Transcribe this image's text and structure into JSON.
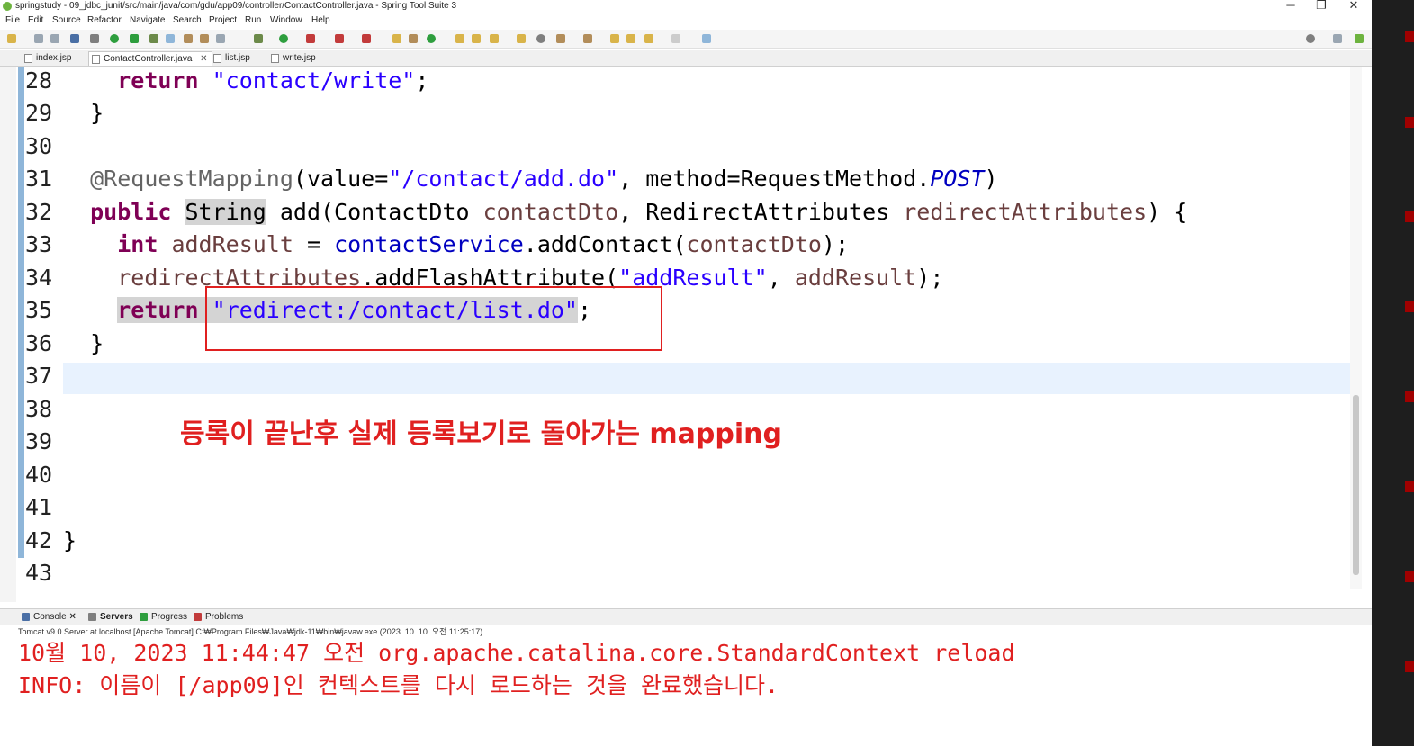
{
  "window": {
    "title": "springstudy - 09_jdbc_junit/src/main/java/com/gdu/app09/controller/ContactController.java - Spring Tool Suite 3",
    "minimize": "─",
    "restore": "❐",
    "close": "✕"
  },
  "menu": [
    "File",
    "Edit",
    "Source",
    "Refactor",
    "Navigate",
    "Search",
    "Project",
    "Run",
    "Window",
    "Help"
  ],
  "tabs": [
    {
      "label": "index.jsp"
    },
    {
      "label": "ContactController.java",
      "close": "✕"
    },
    {
      "label": "list.jsp"
    },
    {
      "label": "write.jsp"
    }
  ],
  "line_numbers": [
    "28",
    "29",
    "30",
    "31",
    "32",
    "33",
    "34",
    "35",
    "36",
    "37",
    "38",
    "39",
    "40",
    "41",
    "42",
    "43"
  ],
  "code": {
    "l28_kw": "return",
    "l28_str": "\"contact/write\"",
    "l28_end": ";",
    "l29": "}",
    "l31_ann": "@RequestMapping",
    "l31_a": "(value=",
    "l31_str": "\"/contact/add.do\"",
    "l31_b": ", method=RequestMethod.",
    "l31_static": "POST",
    "l31_c": ")",
    "l32_kw": "public",
    "l32_type": "String",
    "l32_a": " add(ContactDto ",
    "l32_p1": "contactDto",
    "l32_b": ", RedirectAttributes ",
    "l32_p2": "redirectAttributes",
    "l32_c": ") {",
    "l33_kw": "int",
    "l33_var": "addResult",
    "l33_a": " = ",
    "l33_field": "contactService",
    "l33_b": ".addContact(",
    "l33_p": "contactDto",
    "l33_c": ");",
    "l34_p": "redirectAttributes",
    "l34_a": ".addFlashAttribute(",
    "l34_str": "\"addResult\"",
    "l34_b": ", ",
    "l34_var": "addResult",
    "l34_c": ");",
    "l35_kw": "return",
    "l35_str": "\"redirect:/contact/list.do\"",
    "l35_end": ";",
    "l36": "}",
    "l42": "}"
  },
  "annotation_note": "등록이 끝난후 실제 등록보기로 돌아가는 mapping",
  "console_tabs": [
    "Console",
    "Servers",
    "Progress",
    "Problems"
  ],
  "console_description": "Tomcat v9.0 Server at localhost [Apache Tomcat] C:₩Program Files₩Java₩jdk-11₩bin₩javaw.exe  (2023. 10. 10. 오전 11:25:17)",
  "console_lines": [
    "10월 10, 2023 11:44:47 오전 org.apache.catalina.core.StandardContext reload",
    "INFO: 이름이 [/app09]인 컨텍스트를 다시 로드하는 것을 완료했습니다."
  ],
  "colors": {
    "accent_red": "#e02020",
    "keyword": "#7f0055",
    "string": "#2a00ff"
  }
}
